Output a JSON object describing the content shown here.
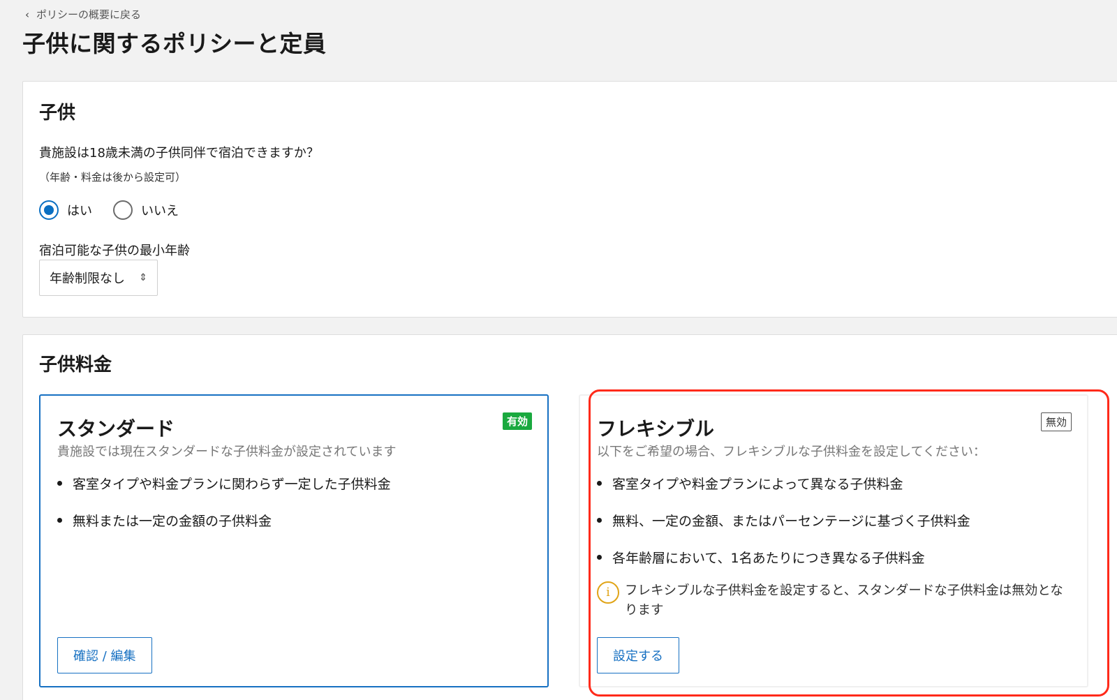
{
  "nav": {
    "back_label": "ポリシーの概要に戻る"
  },
  "page": {
    "title": "子供に関するポリシーと定員"
  },
  "children_section": {
    "title": "子供",
    "question": "貴施設は18歳未満の子供同伴で宿泊できますか？",
    "note": "（年齢・料金は後から設定可）",
    "options": [
      {
        "label": "はい",
        "checked": true
      },
      {
        "label": "いいえ",
        "checked": false
      }
    ],
    "min_age_label": "宿泊可能な子供の最小年齢",
    "min_age_value": "年齢制限なし"
  },
  "fees_section": {
    "title": "子供料金",
    "standard": {
      "title": "スタンダード",
      "badge": "有効",
      "subtitle": "貴施設では現在スタンダードな子供料金が設定されています",
      "bullets": [
        "客室タイプや料金プランに関わらず一定した子供料金",
        "無料または一定の金額の子供料金"
      ],
      "button_label": "確認 / 編集"
    },
    "flexible": {
      "title": "フレキシブル",
      "badge": "無効",
      "subtitle": "以下をご希望の場合、フレキシブルな子供料金を設定してください：",
      "bullets": [
        "客室タイプや料金プランによって異なる子供料金",
        "無料、一定の金額、またはパーセンテージに基づく子供料金",
        "各年齢層において、1名あたりにつき異なる子供料金"
      ],
      "info": "フレキシブルな子供料金を設定すると、スタンダードな子供料金は無効となります",
      "button_label": "設定する"
    }
  },
  "colors": {
    "accent": "#1670c2",
    "badge_active": "#1aa93f",
    "highlight": "#ff2a1a",
    "info": "#e0a417"
  }
}
